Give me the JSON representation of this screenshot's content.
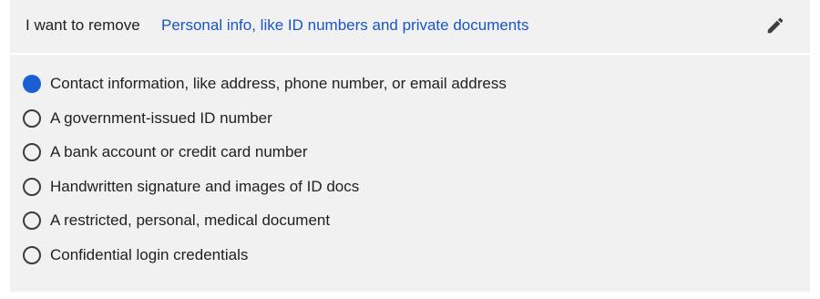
{
  "header": {
    "label": "I want to remove",
    "value": "Personal info, like ID numbers and private documents"
  },
  "edit_icon": "pencil-icon",
  "options": [
    {
      "label": "Contact information, like address, phone number, or email address",
      "selected": true
    },
    {
      "label": "A government-issued ID number",
      "selected": false
    },
    {
      "label": "A bank account or credit card number",
      "selected": false
    },
    {
      "label": "Handwritten signature and images of ID docs",
      "selected": false
    },
    {
      "label": "A restricted, personal, medical document",
      "selected": false
    },
    {
      "label": "Confidential login credentials",
      "selected": false
    }
  ],
  "colors": {
    "panel_bg": "#f1f1f1",
    "link_blue": "#1a55c4",
    "radio_selected": "#1a5fd3"
  }
}
